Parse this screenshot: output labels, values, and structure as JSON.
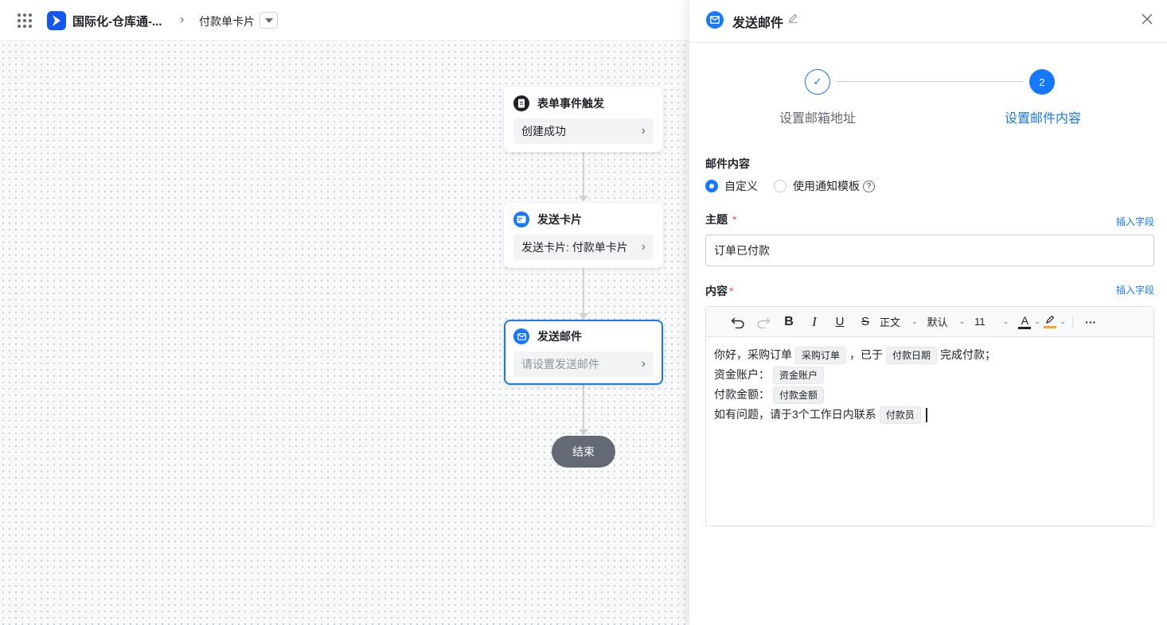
{
  "topbar": {
    "app_name": "国际化-仓库通-...",
    "breadcrumb_separator": "›",
    "page_name": "付款单卡片"
  },
  "flow": {
    "nodes": [
      {
        "title": "表单事件触发",
        "body": "创建成功",
        "icon": "document-icon"
      },
      {
        "title": "发送卡片",
        "body": "发送卡片: 付款单卡片",
        "icon": "card-icon"
      },
      {
        "title": "发送邮件",
        "body": "请设置发送邮件",
        "icon": "mail-icon"
      }
    ],
    "end_label": "结束"
  },
  "panel": {
    "title": "发送邮件",
    "steps": [
      {
        "number": "✓",
        "label": "设置邮箱地址",
        "state": "done"
      },
      {
        "number": "2",
        "label": "设置邮件内容",
        "state": "active"
      }
    ],
    "mail_content_label": "邮件内容",
    "radio_options": [
      {
        "label": "自定义",
        "selected": true
      },
      {
        "label": "使用通知模板",
        "selected": false
      }
    ],
    "subject_label": "主题",
    "subject_required": "*",
    "subject_value": "订单已付款",
    "insert_field_label": "插入字段",
    "content_label": "内容",
    "content_required": "*",
    "toolbar": {
      "paragraph_style": "正文",
      "font_family": "默认",
      "font_size": "11",
      "text_color_label": "A",
      "more": "···"
    },
    "body": {
      "line1_a": "你好，采购订单",
      "line1_chip1": "采购订单",
      "line1_b": "，已于",
      "line1_chip2": "付款日期",
      "line1_c": "完成付款；",
      "line2_a": "资金账户：",
      "line2_chip": "资金账户",
      "line3_a": "付款金额：",
      "line3_chip": "付款金额",
      "line4_a": "如有问题，请于3个工作日内联系",
      "line4_chip": "付款员"
    }
  },
  "colors": {
    "accent": "#1677ff",
    "end_node": "#646a73",
    "required": "#f54a45",
    "highlight": "#f5a623"
  }
}
